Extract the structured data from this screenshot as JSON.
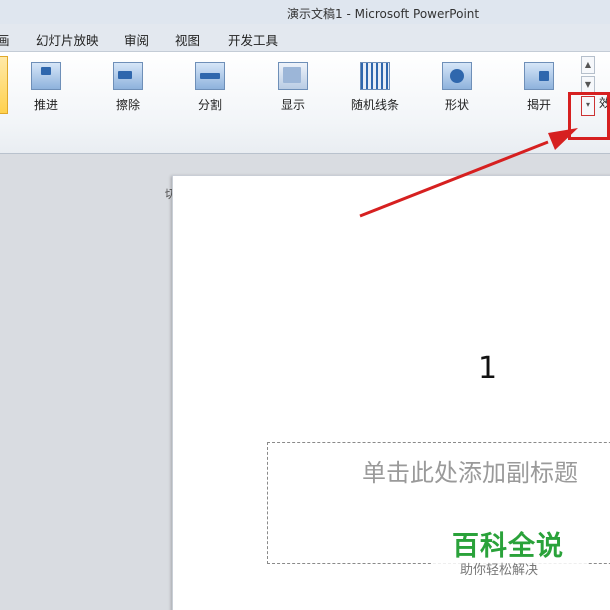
{
  "window": {
    "title": "演示文稿1 - Microsoft PowerPoint"
  },
  "menu": {
    "tabs": [
      {
        "label": "画"
      },
      {
        "label": "幻灯片放映"
      },
      {
        "label": "审阅"
      },
      {
        "label": "视图"
      },
      {
        "label": "开发工具"
      }
    ]
  },
  "ribbon": {
    "transitions": [
      {
        "label": "推进",
        "icon": "push-transition-icon"
      },
      {
        "label": "擦除",
        "icon": "wipe-transition-icon"
      },
      {
        "label": "分割",
        "icon": "split-transition-icon"
      },
      {
        "label": "显示",
        "icon": "reveal-transition-icon"
      },
      {
        "label": "随机线条",
        "icon": "random-bars-transition-icon"
      },
      {
        "label": "形状",
        "icon": "shape-transition-icon"
      },
      {
        "label": "揭开",
        "icon": "uncover-transition-icon"
      }
    ],
    "clipped_label": "效",
    "group_label": "切换到此幻灯片",
    "scroll_up": "▲",
    "scroll_down": "▼",
    "more": "▾"
  },
  "slide": {
    "number": "1",
    "subtitle_placeholder": "单击此处添加副标题"
  },
  "watermark": {
    "title": "百科全说",
    "subtitle": "助你轻松解决"
  },
  "colors": {
    "annotation": "#d62020",
    "watermark_green": "#2aa23a"
  }
}
